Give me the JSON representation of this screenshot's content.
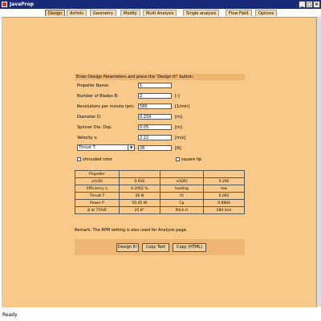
{
  "window": {
    "title": "JavaProp"
  },
  "tabs": [
    "Design",
    "Airfoils",
    "Geometry",
    "Modify",
    "Multi Analysis",
    "Single analysis",
    "Flow Field",
    "Options"
  ],
  "instruction": "Enter Design Parameters and press the 'Design It!' button.",
  "form": {
    "propeller_name": {
      "label": "Propeller Name:",
      "value": "1"
    },
    "blades": {
      "label": "Number of Blades  B:",
      "value": "2",
      "unit": "[-]"
    },
    "rpm": {
      "label": "Revolutions per minute  rpm:",
      "value": "580",
      "unit": "[1/min]"
    },
    "diameter": {
      "label": "Diameter  D:",
      "value": "0.259",
      "unit": "[m]"
    },
    "spinner": {
      "label": "Spinner Dia.  Dsp:",
      "value": "0.05",
      "unit": "[m]"
    },
    "velocity": {
      "label": "Velocity  v:",
      "value": "2.22",
      "unit": "[m/s]"
    },
    "thrust": {
      "select": "Thrust  T:",
      "value": "26",
      "unit": "[N]"
    },
    "shrouded_label": "shrouded rotor",
    "square_tip_label": "square tip"
  },
  "results": {
    "rows": [
      [
        "Propeller",
        "",
        "",
        ""
      ],
      [
        "v/(nD)",
        "0.916",
        "v/(ΩR)",
        "0.292"
      ],
      [
        "Efficiency η",
        "0.2062 %",
        "loading",
        "low"
      ],
      [
        "Thrust  T",
        "26 N",
        "Ct",
        "0.081"
      ],
      [
        "Power  P",
        "50.45 W",
        "Cp",
        "0.0884"
      ],
      [
        "β at 75%R",
        "25.8°",
        "Pitch H",
        "284 mm"
      ]
    ]
  },
  "remark": "Remark: The RPM setting is also used for Analysis page.",
  "buttons": {
    "design": "Design It!",
    "copy_text": "Copy Text",
    "copy_html": "Copy (HTML)"
  },
  "status": "Ready"
}
